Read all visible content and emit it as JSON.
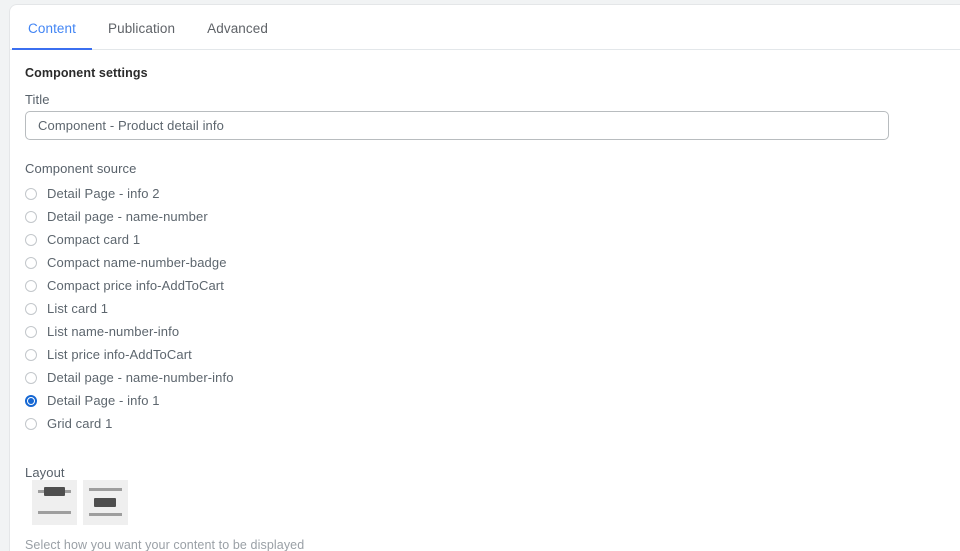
{
  "tabs": [
    {
      "label": "Content",
      "active": true
    },
    {
      "label": "Publication",
      "active": false
    },
    {
      "label": "Advanced",
      "active": false
    }
  ],
  "panel": {
    "section_heading": "Component settings",
    "title_label": "Title",
    "title_value": "Component - Product detail info",
    "title_placeholder": "Component - Product detail info",
    "source_label": "Component source",
    "layout_label": "Layout",
    "helper_text": "Select how you want your content to be displayed"
  },
  "component_source": {
    "selected": "Detail Page - info 1",
    "options": [
      {
        "label": "Detail Page - info 2",
        "selected": false
      },
      {
        "label": "Detail page - name-number",
        "selected": false
      },
      {
        "label": "Compact card 1",
        "selected": false
      },
      {
        "label": "Compact name-number-badge",
        "selected": false
      },
      {
        "label": "Compact price info-AddToCart",
        "selected": false
      },
      {
        "label": "List card 1",
        "selected": false
      },
      {
        "label": "List name-number-info",
        "selected": false
      },
      {
        "label": "List price info-AddToCart",
        "selected": false
      },
      {
        "label": "Detail page - name-number-info",
        "selected": false
      },
      {
        "label": "Detail Page - info 1",
        "selected": true
      },
      {
        "label": "Grid card 1",
        "selected": false
      }
    ]
  },
  "layout": {
    "options": [
      {
        "name": "layout-image-top",
        "selected": false
      },
      {
        "name": "layout-image-middle",
        "selected": false
      }
    ]
  },
  "colors": {
    "accent": "#4285f4",
    "tab_underline": "#3b6ff0",
    "radio_selected": "#1567d3",
    "text_primary": "#2b2b2b",
    "text_secondary": "#5d666e",
    "text_muted": "#9aa0a6",
    "border": "#b8bcbf",
    "page_background": "#f1f3f4",
    "thumb_background": "#efefef",
    "thumb_bar": "#9e9e9e",
    "thumb_block": "#4e4e4e"
  }
}
